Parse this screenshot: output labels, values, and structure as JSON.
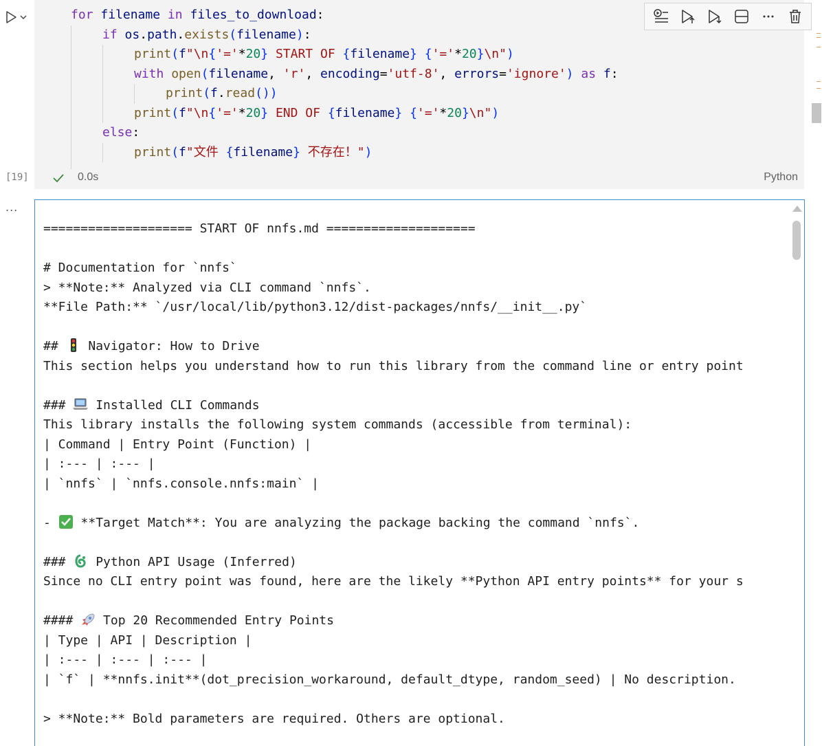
{
  "cell": {
    "execution_count": "[19]",
    "duration": "0.0s",
    "language": "Python",
    "code_lines": [
      {
        "indent": 1,
        "tokens": [
          [
            "kw",
            "for"
          ],
          [
            "punct",
            " "
          ],
          [
            "var",
            "filename"
          ],
          [
            "punct",
            " "
          ],
          [
            "kw",
            "in"
          ],
          [
            "punct",
            " "
          ],
          [
            "var",
            "files_to_download"
          ],
          [
            "punct",
            ":"
          ]
        ]
      },
      {
        "indent": 2,
        "tokens": [
          [
            "kw",
            "if"
          ],
          [
            "punct",
            " "
          ],
          [
            "var",
            "os"
          ],
          [
            "punct",
            "."
          ],
          [
            "var",
            "path"
          ],
          [
            "punct",
            "."
          ],
          [
            "fn",
            "exists"
          ],
          [
            "brace",
            "("
          ],
          [
            "var",
            "filename"
          ],
          [
            "brace",
            ")"
          ],
          [
            "punct",
            ":"
          ]
        ]
      },
      {
        "indent": 3,
        "tokens": [
          [
            "fn",
            "print"
          ],
          [
            "brace",
            "("
          ],
          [
            "var",
            "f"
          ],
          [
            "str",
            "\"\\n"
          ],
          [
            "brace",
            "{"
          ],
          [
            "str",
            "'='"
          ],
          [
            "punct",
            "*"
          ],
          [
            "num",
            "20"
          ],
          [
            "brace",
            "}"
          ],
          [
            "str",
            " START OF "
          ],
          [
            "brace",
            "{"
          ],
          [
            "var",
            "filename"
          ],
          [
            "brace",
            "}"
          ],
          [
            "str",
            " "
          ],
          [
            "brace",
            "{"
          ],
          [
            "str",
            "'='"
          ],
          [
            "punct",
            "*"
          ],
          [
            "num",
            "20"
          ],
          [
            "brace",
            "}"
          ],
          [
            "str",
            "\\n\""
          ],
          [
            "brace",
            ")"
          ]
        ]
      },
      {
        "indent": 3,
        "tokens": [
          [
            "kw",
            "with"
          ],
          [
            "punct",
            " "
          ],
          [
            "fn",
            "open"
          ],
          [
            "brace",
            "("
          ],
          [
            "var",
            "filename"
          ],
          [
            "punct",
            ", "
          ],
          [
            "str",
            "'r'"
          ],
          [
            "punct",
            ", "
          ],
          [
            "var",
            "encoding"
          ],
          [
            "punct",
            "="
          ],
          [
            "str",
            "'utf-8'"
          ],
          [
            "punct",
            ", "
          ],
          [
            "var",
            "errors"
          ],
          [
            "punct",
            "="
          ],
          [
            "str",
            "'ignore'"
          ],
          [
            "brace",
            ")"
          ],
          [
            "punct",
            " "
          ],
          [
            "kw",
            "as"
          ],
          [
            "punct",
            " "
          ],
          [
            "var",
            "f"
          ],
          [
            "punct",
            ":"
          ]
        ]
      },
      {
        "indent": 4,
        "tokens": [
          [
            "fn",
            "print"
          ],
          [
            "brace",
            "("
          ],
          [
            "var",
            "f"
          ],
          [
            "punct",
            "."
          ],
          [
            "fn",
            "read"
          ],
          [
            "brace",
            "())"
          ]
        ]
      },
      {
        "indent": 3,
        "tokens": [
          [
            "fn",
            "print"
          ],
          [
            "brace",
            "("
          ],
          [
            "var",
            "f"
          ],
          [
            "str",
            "\"\\n"
          ],
          [
            "brace",
            "{"
          ],
          [
            "str",
            "'='"
          ],
          [
            "punct",
            "*"
          ],
          [
            "num",
            "20"
          ],
          [
            "brace",
            "}"
          ],
          [
            "str",
            " END OF "
          ],
          [
            "brace",
            "{"
          ],
          [
            "var",
            "filename"
          ],
          [
            "brace",
            "}"
          ],
          [
            "str",
            " "
          ],
          [
            "brace",
            "{"
          ],
          [
            "str",
            "'='"
          ],
          [
            "punct",
            "*"
          ],
          [
            "num",
            "20"
          ],
          [
            "brace",
            "}"
          ],
          [
            "str",
            "\\n\""
          ],
          [
            "brace",
            ")"
          ]
        ]
      },
      {
        "indent": 2,
        "tokens": [
          [
            "kw",
            "else"
          ],
          [
            "punct",
            ":"
          ]
        ]
      },
      {
        "indent": 3,
        "tokens": [
          [
            "fn",
            "print"
          ],
          [
            "brace",
            "("
          ],
          [
            "var",
            "f"
          ],
          [
            "str",
            "\"文件 "
          ],
          [
            "brace",
            "{"
          ],
          [
            "var",
            "filename"
          ],
          [
            "brace",
            "}"
          ],
          [
            "str",
            " 不存在！\""
          ],
          [
            "brace",
            ")"
          ]
        ]
      }
    ]
  },
  "toolbar": {
    "icons": [
      "run-by-line-icon",
      "execute-above-icon",
      "execute-below-icon",
      "split-cell-icon",
      "more-actions-icon",
      "delete-cell-icon"
    ]
  },
  "output": {
    "more_label": "...",
    "lines": [
      {
        "text": "==================== START OF nnfs.md ===================="
      },
      {
        "text": ""
      },
      {
        "text": "# Documentation for `nnfs`"
      },
      {
        "text": "> **Note:** Analyzed via CLI command `nnfs`."
      },
      {
        "text": "**File Path:** `/usr/local/lib/python3.12/dist-packages/nnfs/__init__.py`"
      },
      {
        "text": ""
      },
      {
        "prefix": "## ",
        "emoji": "traffic-light-icon",
        "text": " Navigator: How to Drive"
      },
      {
        "text": "This section helps you understand how to run this library from the command line or entry point"
      },
      {
        "text": ""
      },
      {
        "prefix": "### ",
        "emoji": "laptop-icon",
        "text": " Installed CLI Commands"
      },
      {
        "text": "This library installs the following system commands (accessible from terminal):"
      },
      {
        "text": "| Command | Entry Point (Function) |"
      },
      {
        "text": "| :--- | :--- |"
      },
      {
        "text": "| `nnfs` | `nnfs.console.nnfs:main` |"
      },
      {
        "text": ""
      },
      {
        "prefix": "- ",
        "emoji": "check-mark-icon",
        "text": " **Target Match**: You are analyzing the package backing the command `nnfs`."
      },
      {
        "text": ""
      },
      {
        "prefix": "### ",
        "emoji": "python-icon",
        "text": " Python API Usage (Inferred)"
      },
      {
        "text": "Since no CLI entry point was found, here are the likely **Python API entry points** for your s"
      },
      {
        "text": ""
      },
      {
        "prefix": "#### ",
        "emoji": "rocket-icon",
        "text": " Top 20 Recommended Entry Points"
      },
      {
        "text": "| Type | API | Description |"
      },
      {
        "text": "| :--- | :--- | :--- |"
      },
      {
        "text": "| `f` | **nnfs.init**(dot_precision_workaround, default_dtype, random_seed) | No description."
      },
      {
        "text": ""
      },
      {
        "text": "> **Note:** Bold parameters are required. Others are optional."
      }
    ]
  }
}
